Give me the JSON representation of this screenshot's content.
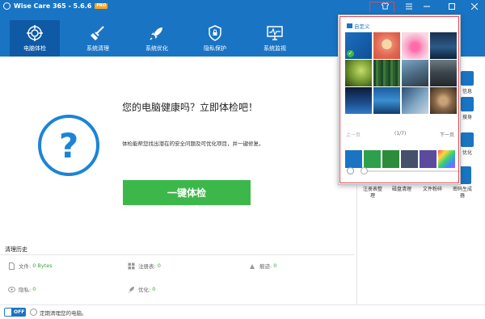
{
  "titlebar": {
    "title": "Wise Care 365 - 5.6.6",
    "badge": "PRO"
  },
  "nav": {
    "items": [
      {
        "label": "电脑体检",
        "icon": "target-icon",
        "active": true
      },
      {
        "label": "系统清理",
        "icon": "broom-icon",
        "active": false
      },
      {
        "label": "系统优化",
        "icon": "rocket-icon",
        "active": false
      },
      {
        "label": "隐私保护",
        "icon": "shield-icon",
        "active": false
      },
      {
        "label": "系统监视",
        "icon": "monitor-icon",
        "active": false
      }
    ]
  },
  "main": {
    "title": "您的电脑健康吗？立即体检吧！",
    "description": "体检能帮您找出潜在的安全问题及可优化项目，并一键修复。",
    "check_button": "一键体检",
    "question_mark": "?"
  },
  "history": {
    "title": "清理历史",
    "items": [
      {
        "label": "文件:",
        "value": "0 Bytes",
        "icon": "file-icon"
      },
      {
        "label": "注册表:",
        "value": "0",
        "icon": "registry-icon"
      },
      {
        "label": "痕迹:",
        "value": "0",
        "icon": "trace-icon"
      },
      {
        "label": "隐私:",
        "value": "0",
        "icon": "eye-icon"
      },
      {
        "label": "优化:",
        "value": "0",
        "icon": "rocket-small-icon"
      }
    ]
  },
  "bottom": {
    "toggle_label": "OFF",
    "schedule_text": "定期清理您的电脑。"
  },
  "right_panel": {
    "side_labels": [
      "信息",
      "搜身",
      "优化"
    ],
    "tools": [
      {
        "label": "注册表整理"
      },
      {
        "label": "磁盘清理"
      },
      {
        "label": "文件粉碎"
      },
      {
        "label": "密码生成器"
      }
    ]
  },
  "skin_popup": {
    "header": "自定义",
    "prev": "上一页",
    "page": "(1/7)",
    "next": "下一页",
    "swatch_colors": [
      "#1a74c4",
      "#2e9f4c",
      "#2d8c3a",
      "#45506a",
      "#5b4a9e",
      "rainbow"
    ]
  },
  "colors": {
    "accent": "#1a74c4",
    "green": "#3cb84a",
    "highlight": "#e8424a"
  }
}
